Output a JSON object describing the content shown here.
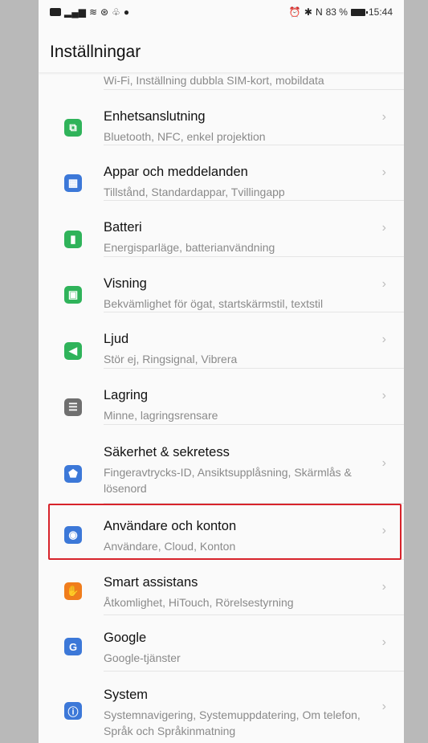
{
  "status_bar": {
    "left_icons": [
      "sim-icon",
      "signal-icon",
      "wifi-icon",
      "notification-icon",
      "notification-icon",
      "record-icon"
    ],
    "battery_text": "83 %",
    "time": "15:44"
  },
  "header": {
    "title": "Inställningar"
  },
  "partial_item": {
    "subtitle": "Wi-Fi, Inställning dubbla SIM-kort, mobildata"
  },
  "items": [
    {
      "title": "Enhetsanslutning",
      "subtitle": "Bluetooth, NFC, enkel projektion",
      "icon": "device-connection-icon",
      "color": "#2fb35a"
    },
    {
      "title": "Appar och meddelanden",
      "subtitle": "Tillstånd, Standardappar, Tvillingapp",
      "icon": "apps-icon",
      "color": "#3c78d8"
    },
    {
      "title": "Batteri",
      "subtitle": "Energisparläge, batterianvändning",
      "icon": "battery-icon",
      "color": "#2fb35a"
    },
    {
      "title": "Visning",
      "subtitle": "Bekvämlighet för ögat, startskärmstil, textstil",
      "icon": "display-icon",
      "color": "#2fb35a"
    },
    {
      "title": "Ljud",
      "subtitle": "Stör ej, Ringsignal, Vibrera",
      "icon": "sound-icon",
      "color": "#2fb35a"
    },
    {
      "title": "Lagring",
      "subtitle": "Minne, lagringsrensare",
      "icon": "storage-icon",
      "color": "#6f6f6f"
    },
    {
      "title": "Säkerhet & sekretess",
      "subtitle": "Fingeravtrycks-ID, Ansiktsupplåsning, Skärmlås & lösenord",
      "icon": "security-icon",
      "color": "#3c78d8"
    },
    {
      "title": "Användare och konton",
      "subtitle": "Användare, Cloud, Konton",
      "icon": "user-icon",
      "color": "#3c78d8"
    },
    {
      "title": "Smart assistans",
      "subtitle": "Åtkomlighet, HiTouch, Rörelsestyrning",
      "icon": "hand-icon",
      "color": "#f07d1c"
    },
    {
      "title": "Google",
      "subtitle": "Google-tjänster",
      "icon": "google-icon",
      "color": "#3c78d8"
    },
    {
      "title": "System",
      "subtitle": "Systemnavigering, Systemuppdatering, Om telefon, Språk och Språkinmatning",
      "icon": "system-icon",
      "color": "#3c78d8"
    }
  ],
  "chevron_glyph": "›",
  "highlight_color": "#d7232b"
}
